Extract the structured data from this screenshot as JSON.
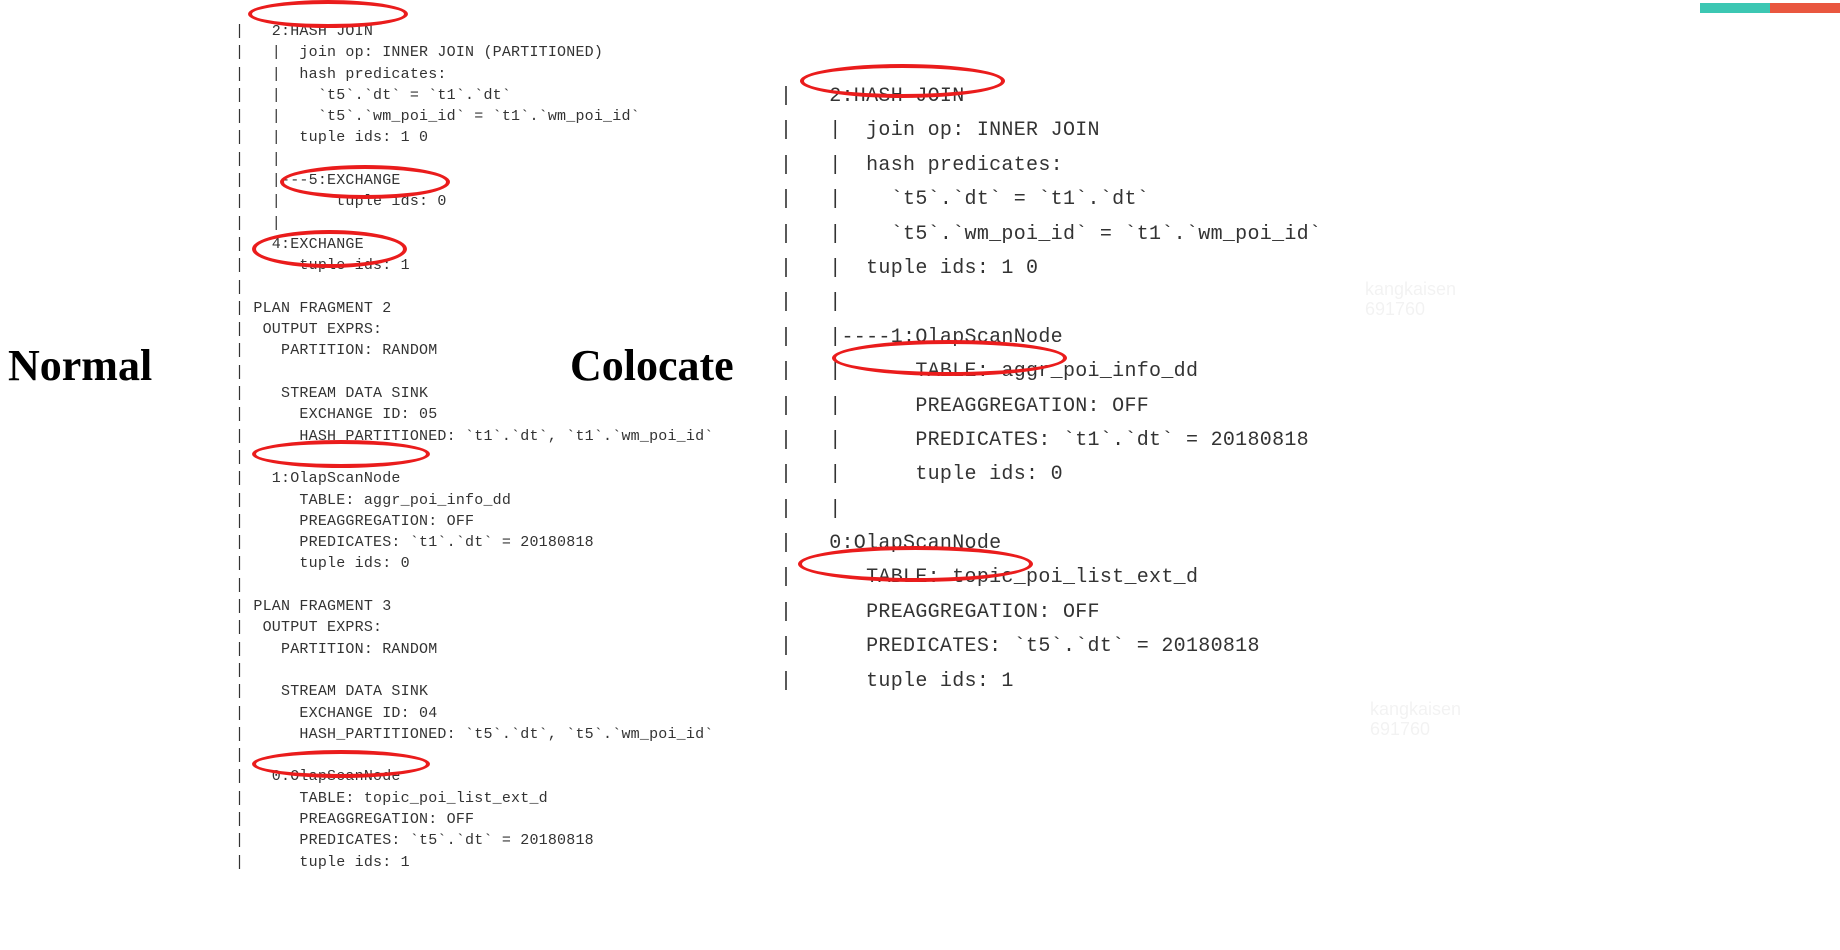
{
  "titles": {
    "normal": "Normal",
    "colocate": "Colocate"
  },
  "watermark": {
    "line1": "kangkaisen",
    "line2": "691760"
  },
  "left_plan": {
    "lines": [
      "|   2:HASH JOIN",
      "|   |  join op: INNER JOIN (PARTITIONED)",
      "|   |  hash predicates:",
      "|   |    `t5`.`dt` = `t1`.`dt`",
      "|   |    `t5`.`wm_poi_id` = `t1`.`wm_poi_id`",
      "|   |  tuple ids: 1 0",
      "|   |",
      "|   |---5:EXCHANGE",
      "|   |      tuple ids: 0",
      "|   |",
      "|   4:EXCHANGE",
      "|      tuple ids: 1",
      "|",
      "| PLAN FRAGMENT 2",
      "|  OUTPUT EXPRS:",
      "|    PARTITION: RANDOM",
      "|",
      "|    STREAM DATA SINK",
      "|      EXCHANGE ID: 05",
      "|      HASH_PARTITIONED: `t1`.`dt`, `t1`.`wm_poi_id`",
      "|",
      "|   1:OlapScanNode",
      "|      TABLE: aggr_poi_info_dd",
      "|      PREAGGREGATION: OFF",
      "|      PREDICATES: `t1`.`dt` = 20180818",
      "|      tuple ids: 0",
      "|",
      "| PLAN FRAGMENT 3",
      "|  OUTPUT EXPRS:",
      "|    PARTITION: RANDOM",
      "|",
      "|    STREAM DATA SINK",
      "|      EXCHANGE ID: 04",
      "|      HASH_PARTITIONED: `t5`.`dt`, `t5`.`wm_poi_id`",
      "|",
      "|   0:OlapScanNode",
      "|      TABLE: topic_poi_list_ext_d",
      "|      PREAGGREGATION: OFF",
      "|      PREDICATES: `t5`.`dt` = 20180818",
      "|      tuple ids: 1"
    ]
  },
  "right_plan": {
    "lines": [
      "|   2:HASH JOIN",
      "|   |  join op: INNER JOIN",
      "|   |  hash predicates:",
      "|   |    `t5`.`dt` = `t1`.`dt`",
      "|   |    `t5`.`wm_poi_id` = `t1`.`wm_poi_id`",
      "|   |  tuple ids: 1 0",
      "|   |",
      "|   |----1:OlapScanNode",
      "|   |      TABLE: aggr_poi_info_dd",
      "|   |      PREAGGREGATION: OFF",
      "|   |      PREDICATES: `t1`.`dt` = 20180818",
      "|   |      tuple ids: 0",
      "|   |",
      "|   0:OlapScanNode",
      "|      TABLE: topic_poi_list_ext_d",
      "|      PREAGGREGATION: OFF",
      "|      PREDICATES: `t5`.`dt` = 20180818",
      "|      tuple ids: 1"
    ]
  },
  "highlights": {
    "left": [
      "2:HASH JOIN",
      "5:EXCHANGE",
      "4:EXCHANGE",
      "1:OlapScanNode",
      "0:OlapScanNode"
    ],
    "right": [
      "2:HASH JOIN",
      "1:OlapScanNode",
      "0:OlapScanNode"
    ]
  }
}
